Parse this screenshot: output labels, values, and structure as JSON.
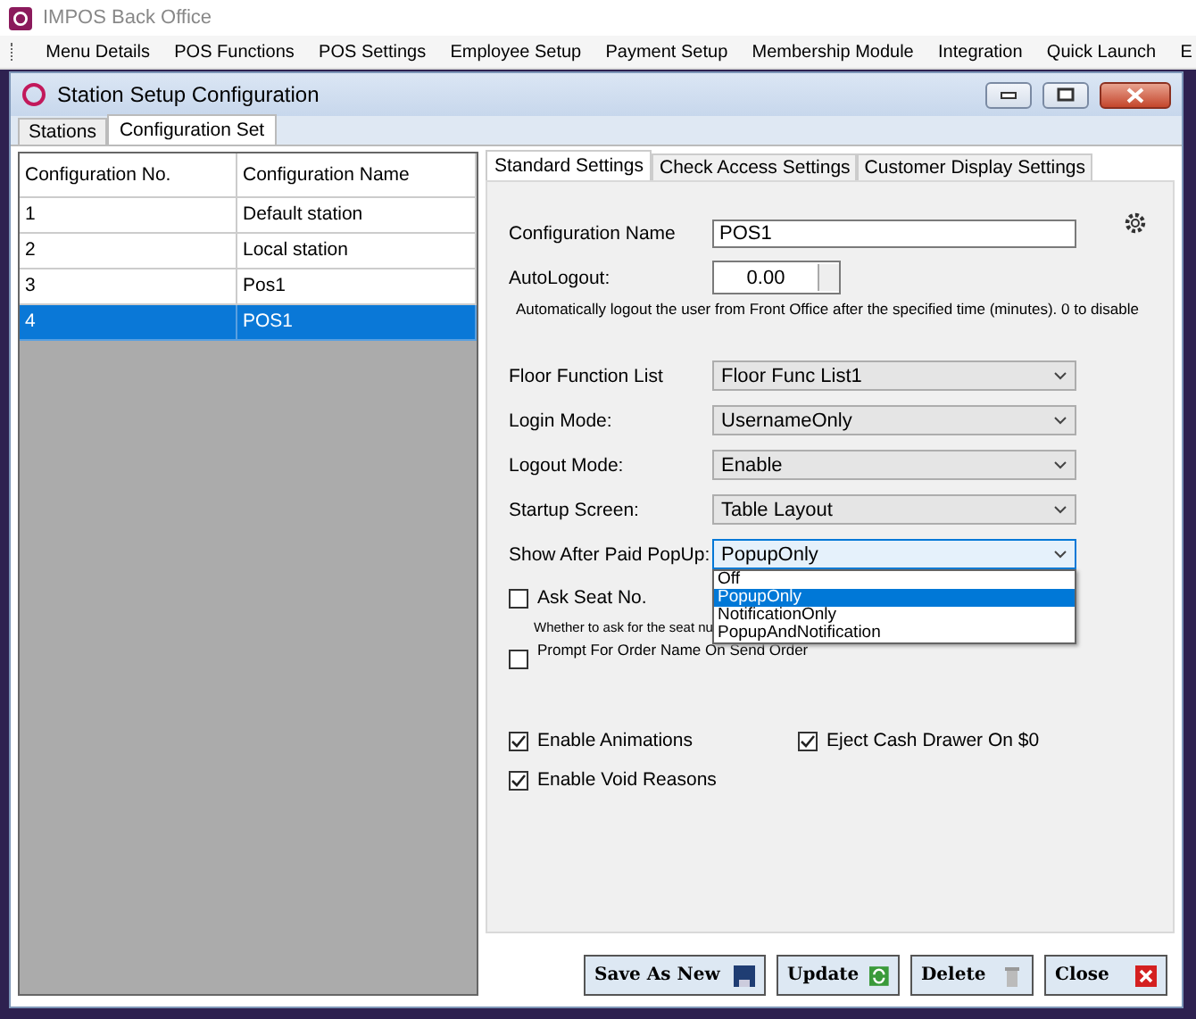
{
  "app": {
    "title": "IMPOS Back Office"
  },
  "menu": [
    "Menu Details",
    "POS Functions",
    "POS Settings",
    "Employee Setup",
    "Payment Setup",
    "Membership Module",
    "Integration",
    "Quick Launch",
    "E"
  ],
  "window": {
    "title": "Station Setup Configuration"
  },
  "window_tabs": [
    {
      "label": "Stations",
      "selected": false
    },
    {
      "label": "Configuration Set",
      "selected": true
    }
  ],
  "grid": {
    "columns": [
      "Configuration No.",
      "Configuration Name"
    ],
    "rows": [
      {
        "no": "1",
        "name": "Default station",
        "selected": false
      },
      {
        "no": "2",
        "name": "Local station",
        "selected": false
      },
      {
        "no": "3",
        "name": "Pos1",
        "selected": false
      },
      {
        "no": "4",
        "name": "POS1",
        "selected": true
      }
    ]
  },
  "settings_tabs": [
    {
      "label": "Standard Settings",
      "selected": true
    },
    {
      "label": "Check Access Settings",
      "selected": false
    },
    {
      "label": "Customer Display Settings",
      "selected": false
    }
  ],
  "form": {
    "name_label": "Configuration Name",
    "name_value": "POS1",
    "autologout_label": "AutoLogout:",
    "autologout_value": "0.00",
    "autologout_hint": "Automatically logout the user from Front Office after the specified time (minutes). 0 to disable",
    "selects": [
      {
        "label": "Floor Function List",
        "value": "Floor Func List1",
        "open": false
      },
      {
        "label": "Login Mode:",
        "value": "UsernameOnly",
        "open": false
      },
      {
        "label": "Logout Mode:",
        "value": "Enable",
        "open": false
      },
      {
        "label": "Startup Screen:",
        "value": "Table Layout",
        "open": false
      },
      {
        "label": "Show After Paid PopUp:",
        "value": "PopupOnly",
        "open": true
      }
    ],
    "dropdown_options": [
      {
        "label": "Off",
        "selected": false
      },
      {
        "label": "PopupOnly",
        "selected": true
      },
      {
        "label": "NotificationOnly",
        "selected": false
      },
      {
        "label": "PopupAndNotification",
        "selected": false
      }
    ],
    "ask_seat": {
      "label": "Ask Seat No.",
      "checked": false,
      "hint": "Whether to ask for the seat nu"
    },
    "prompt_order": {
      "label": "Prompt For Order Name On Send Order",
      "checked": false
    },
    "options": [
      {
        "label": "Enable Animations",
        "checked": true
      },
      {
        "label": "Eject Cash Drawer On $0",
        "checked": true
      },
      {
        "label": "Enable Void Reasons",
        "checked": true
      }
    ]
  },
  "buttons": [
    {
      "label": "Save As New",
      "kind": "save"
    },
    {
      "label": "Update",
      "kind": "update"
    },
    {
      "label": "Delete",
      "kind": "delete"
    },
    {
      "label": "Close",
      "kind": "close"
    }
  ]
}
